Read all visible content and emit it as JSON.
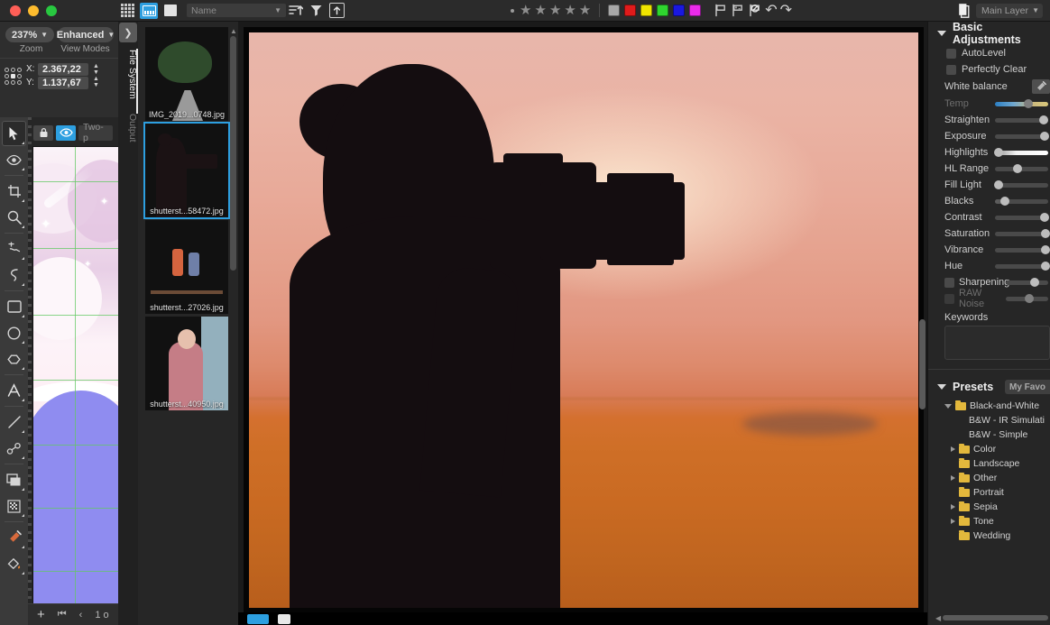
{
  "window": {
    "traffic_lights": [
      "close",
      "minimize",
      "zoom"
    ]
  },
  "toolbar": {
    "view_grid": "grid-view",
    "view_filmstrip": "filmstrip-view",
    "view_single": "single-view",
    "sort_dropdown_value": "Name",
    "sort_asc": "sort-ascending",
    "filter": "filter",
    "export": "export-up",
    "rating_stars": 5,
    "rating_value": 0,
    "color_labels": [
      "#a8a8a8",
      "#e01b1b",
      "#f0e500",
      "#2fd62f",
      "#1a18e0",
      "#ea2bea"
    ],
    "flag_icons": [
      "flag",
      "flag-picked",
      "flag-rejected"
    ],
    "undo": "undo",
    "redo": "redo",
    "layer_dropdown_value": "Main Layer"
  },
  "left_panel": {
    "zoom_value": "237%",
    "zoom_label": "Zoom",
    "view_mode_value": "Enhanced",
    "view_mode_label": "View Modes",
    "coords": {
      "x_key": "X:",
      "x_value": "2.367,22",
      "y_key": "Y:",
      "y_value": "1.137,67"
    },
    "tools": [
      {
        "name": "pointer-tool",
        "selected": true
      },
      {
        "name": "redeye-tool",
        "selected": false
      },
      {
        "name": "crop-tool",
        "selected": false
      },
      {
        "name": "zoom-tool",
        "selected": false
      },
      {
        "name": "clone-tool",
        "selected": false
      },
      {
        "name": "curve-tool",
        "selected": false
      },
      {
        "name": "rectangle-tool",
        "selected": false
      },
      {
        "name": "ellipse-tool",
        "selected": false
      },
      {
        "name": "polygon-tool",
        "selected": false
      },
      {
        "name": "text-tool",
        "selected": false
      },
      {
        "name": "line-tool",
        "selected": false
      },
      {
        "name": "path-tool",
        "selected": false
      },
      {
        "name": "frame-tool",
        "selected": false
      },
      {
        "name": "pattern-tool",
        "selected": false
      },
      {
        "name": "eyedropper-tool",
        "selected": false
      },
      {
        "name": "paint-bucket-tool",
        "selected": false
      }
    ],
    "layer_view": {
      "lock_icon": "lock",
      "visibility_icon": "eye",
      "layer_name": "Two-p",
      "footer": {
        "add": "+",
        "first": "first-page",
        "prev": "previous-page",
        "page_label": "1 o"
      }
    }
  },
  "side_tabs": {
    "expand": "expand-chevron",
    "items": [
      {
        "label": "File System",
        "active": true
      },
      {
        "label": "Output",
        "active": false
      }
    ]
  },
  "filmstrip": {
    "thumbnails": [
      {
        "filename": "IMG_2019...0748.jpg",
        "selected": false,
        "art": "t1"
      },
      {
        "filename": "shutterst...58472.jpg",
        "selected": true,
        "art": "t2"
      },
      {
        "filename": "shutterst...27026.jpg",
        "selected": false,
        "art": "t3"
      },
      {
        "filename": "shutterst...40950.jpg",
        "selected": false,
        "art": "t4"
      }
    ]
  },
  "canvas": {
    "image_alt": "Silhouette of a woman photographer holding a DSLR camera with telephoto lens against an orange sunset sky"
  },
  "right_panel": {
    "basic_adjustments": {
      "title": "Basic Adjustments",
      "expanded": true,
      "checkboxes": [
        {
          "label": "AutoLevel",
          "checked": false,
          "disabled": false
        },
        {
          "label": "Perfectly Clear",
          "checked": false,
          "disabled": false
        }
      ],
      "white_balance_label": "White balance",
      "white_balance_picker": "eyedropper-icon",
      "sliders": [
        {
          "label": "Temp",
          "value": 62,
          "disabled": true,
          "track": "temp"
        },
        {
          "label": "Straighten",
          "value": 92,
          "disabled": false,
          "track": "plain"
        },
        {
          "label": "Exposure",
          "value": 94,
          "disabled": false,
          "track": "plain"
        },
        {
          "label": "Highlights",
          "value": 6,
          "disabled": false,
          "track": "hl"
        },
        {
          "label": "HL Range",
          "value": 43,
          "disabled": false,
          "track": "plain"
        },
        {
          "label": "Fill Light",
          "value": 6,
          "disabled": false,
          "track": "plain"
        },
        {
          "label": "Blacks",
          "value": 18,
          "disabled": false,
          "track": "blk"
        },
        {
          "label": "Contrast",
          "value": 93,
          "disabled": false,
          "track": "plain"
        },
        {
          "label": "Saturation",
          "value": 95,
          "disabled": false,
          "track": "plain"
        },
        {
          "label": "Vibrance",
          "value": 95,
          "disabled": false,
          "track": "plain"
        },
        {
          "label": "Hue",
          "value": 95,
          "disabled": false,
          "track": "plain"
        }
      ],
      "checkbox_sliders": [
        {
          "label": "Sharpening",
          "checked": false,
          "disabled": false,
          "value": 68
        },
        {
          "label": "RAW Noise",
          "checked": false,
          "disabled": true,
          "value": 55
        }
      ],
      "keywords_label": "Keywords",
      "keywords_value": ""
    },
    "presets": {
      "title": "Presets",
      "expanded": true,
      "favorites_tab": "My Favo",
      "tree": [
        {
          "label": "Black-and-White",
          "type": "folder",
          "depth": 0,
          "caret": "down"
        },
        {
          "label": "B&W - IR Simulati",
          "type": "item",
          "depth": 1,
          "caret": "none"
        },
        {
          "label": "B&W - Simple",
          "type": "item",
          "depth": 1,
          "caret": "none"
        },
        {
          "label": "Color",
          "type": "folder",
          "depth": 0,
          "caret": "right"
        },
        {
          "label": "Landscape",
          "type": "folder",
          "depth": 0,
          "caret": "none"
        },
        {
          "label": "Other",
          "type": "folder",
          "depth": 0,
          "caret": "right"
        },
        {
          "label": "Portrait",
          "type": "folder",
          "depth": 0,
          "caret": "none"
        },
        {
          "label": "Sepia",
          "type": "folder",
          "depth": 0,
          "caret": "right"
        },
        {
          "label": "Tone",
          "type": "folder",
          "depth": 0,
          "caret": "right"
        },
        {
          "label": "Wedding",
          "type": "folder",
          "depth": 0,
          "caret": "none"
        }
      ]
    }
  },
  "colors": {
    "accent": "#2d9fe0",
    "panel_bg": "#262626",
    "toolbar_bg": "#2b2b2b",
    "folder": "#e3b83c"
  }
}
